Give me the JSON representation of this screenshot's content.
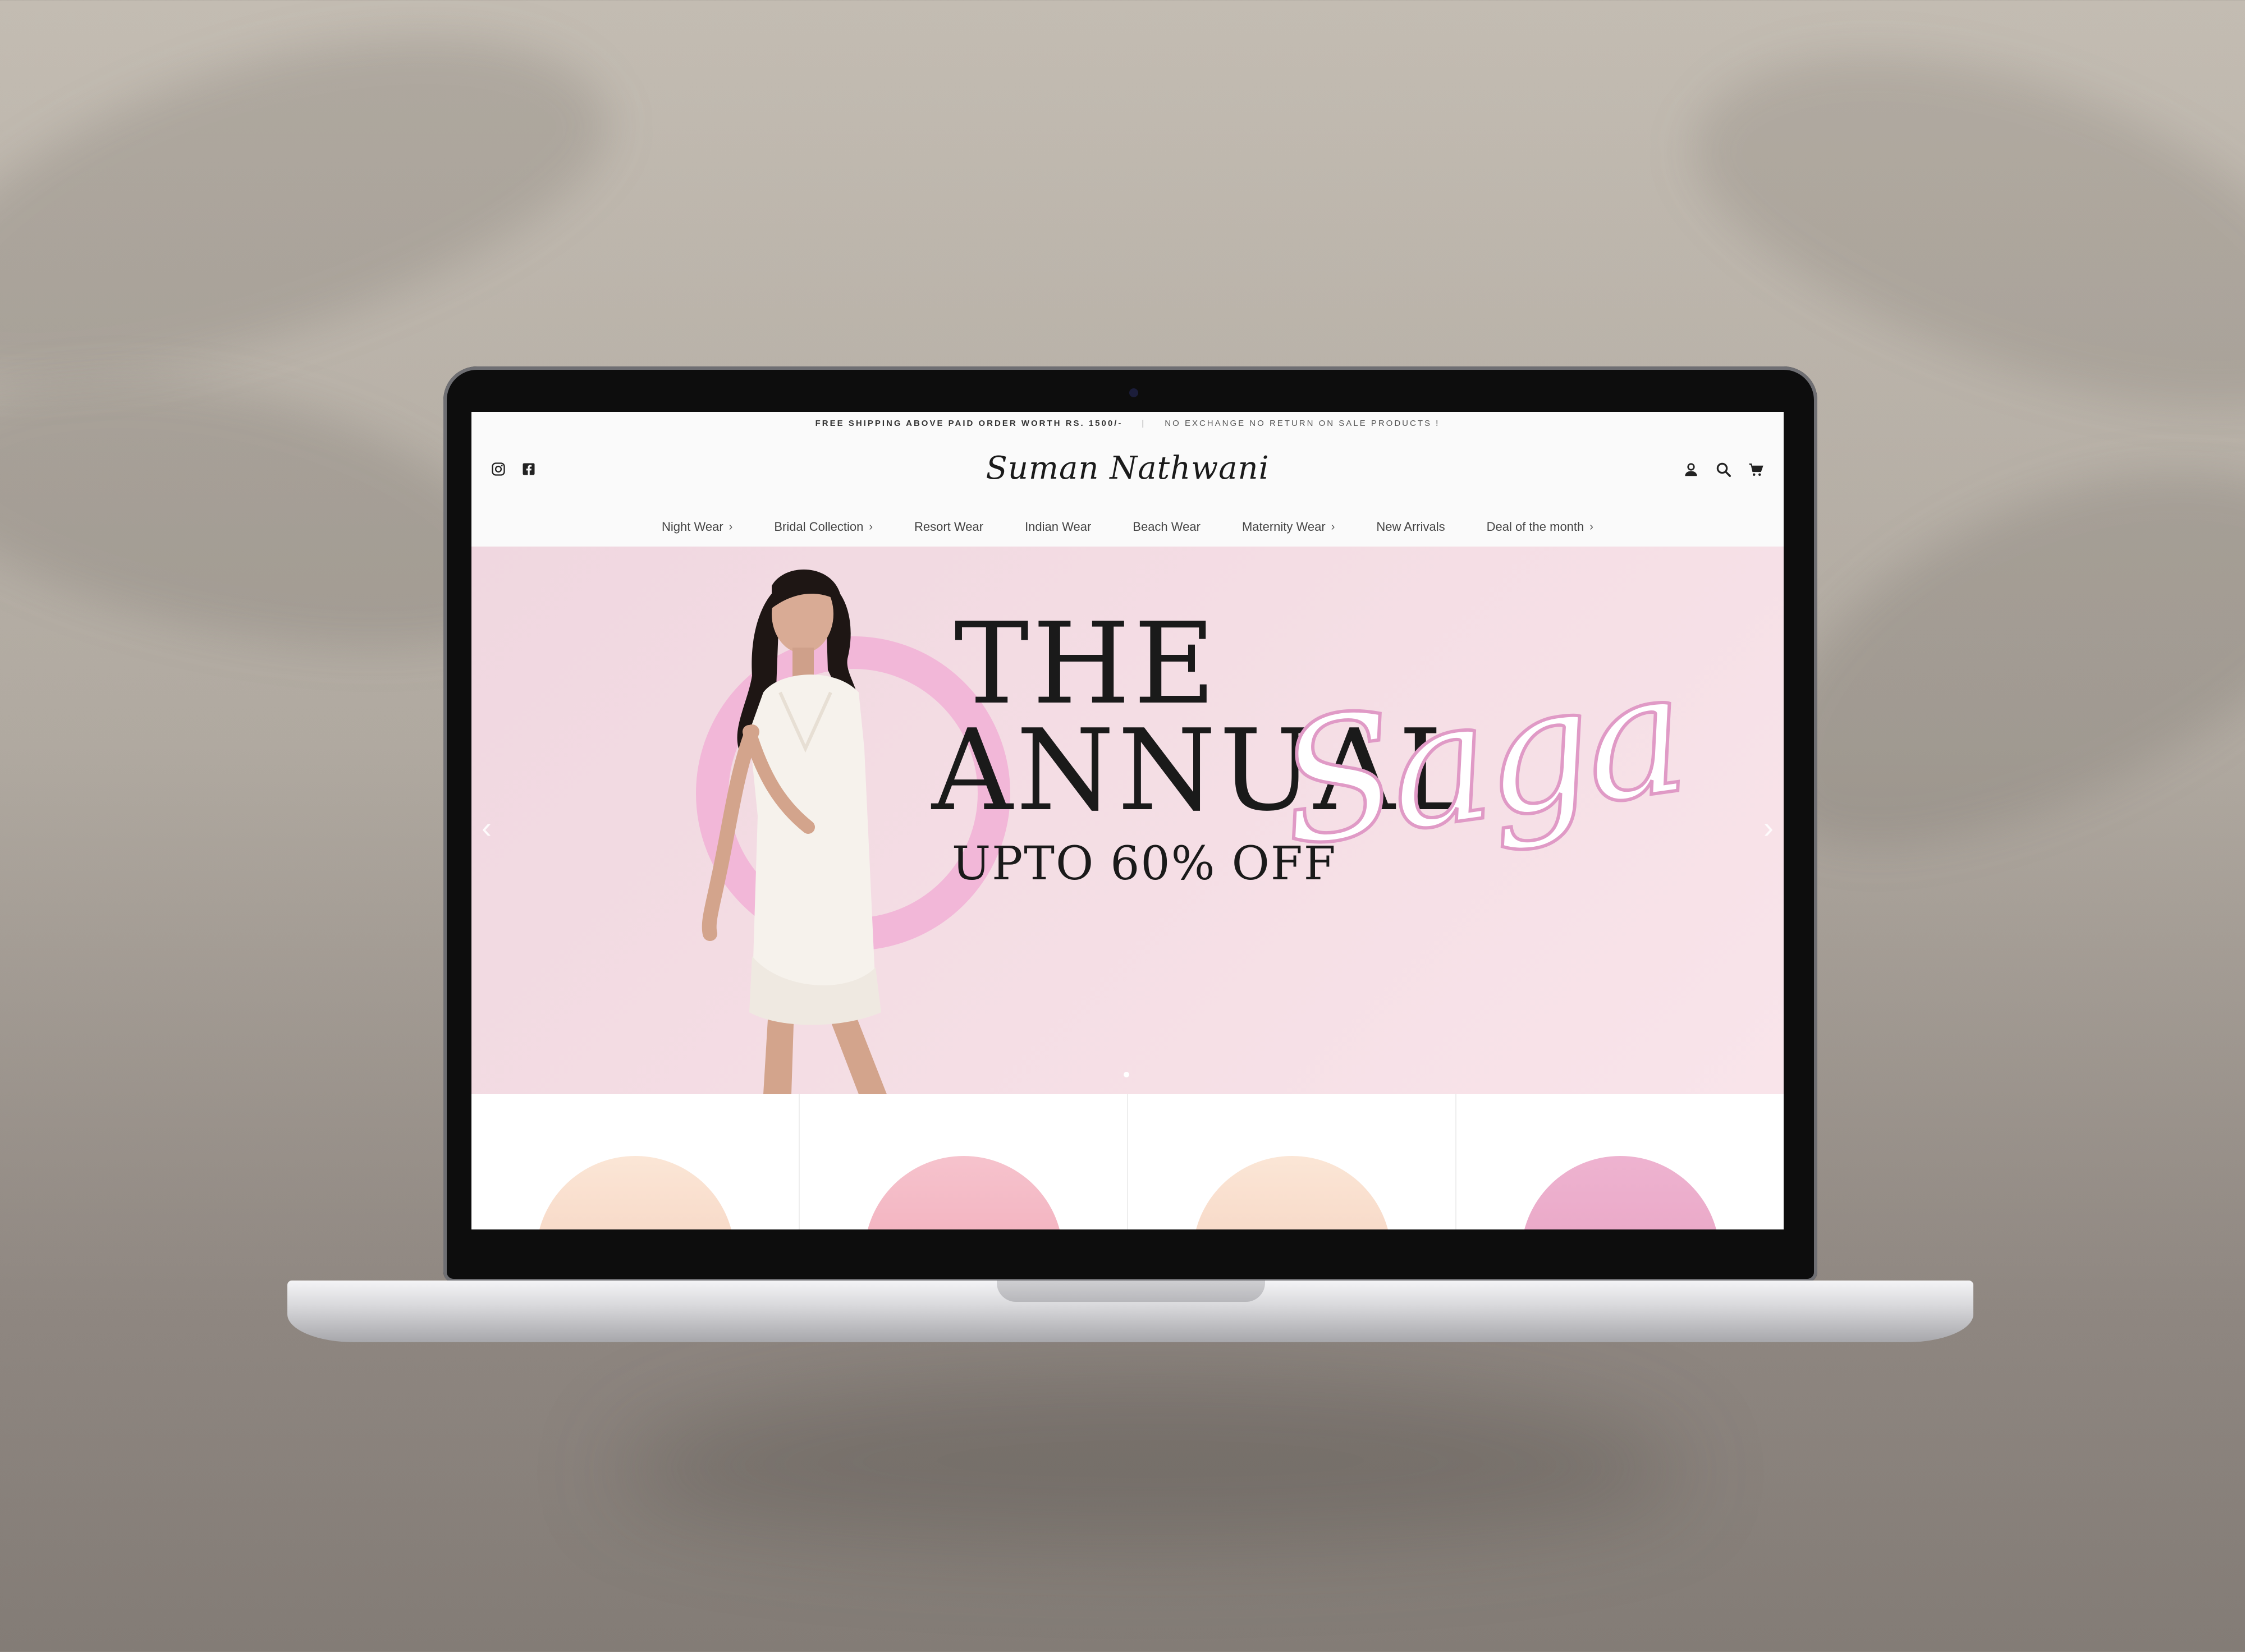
{
  "announcement": {
    "left": "FREE SHIPPING ABOVE PAID ORDER WORTH RS. 1500/-",
    "separator": "|",
    "right": "NO EXCHANGE NO RETURN ON SALE PRODUCTS !"
  },
  "header": {
    "logo": "Suman Nathwani",
    "social_icons": [
      "instagram-icon",
      "facebook-icon"
    ],
    "utility_icons": [
      "account-icon",
      "search-icon",
      "cart-icon"
    ]
  },
  "nav": [
    {
      "label": "Night Wear",
      "chevron": "›"
    },
    {
      "label": "Bridal Collection",
      "chevron": "›"
    },
    {
      "label": "Resort Wear",
      "chevron": ""
    },
    {
      "label": "Indian Wear",
      "chevron": ""
    },
    {
      "label": "Beach Wear",
      "chevron": ""
    },
    {
      "label": "Maternity Wear",
      "chevron": "›"
    },
    {
      "label": "New Arrivals",
      "chevron": ""
    },
    {
      "label": "Deal of the month",
      "chevron": "›"
    }
  ],
  "hero": {
    "line1": "THE",
    "line2": "ANNUAL",
    "script": "Saga",
    "offer": "UPTO 60% OFF",
    "prev": "‹",
    "next": "›",
    "accent_color": "#f2b7d8"
  },
  "categories": [
    {
      "color_top": "#fbe6d6",
      "color_bottom": "#f3c8b4"
    },
    {
      "color_top": "#f6c3cd",
      "color_bottom": "#ef9fb0"
    },
    {
      "color_top": "#fbe6d6",
      "color_bottom": "#f3c8b4"
    },
    {
      "color_top": "#eeb3d0",
      "color_bottom": "#e59bbd"
    }
  ]
}
